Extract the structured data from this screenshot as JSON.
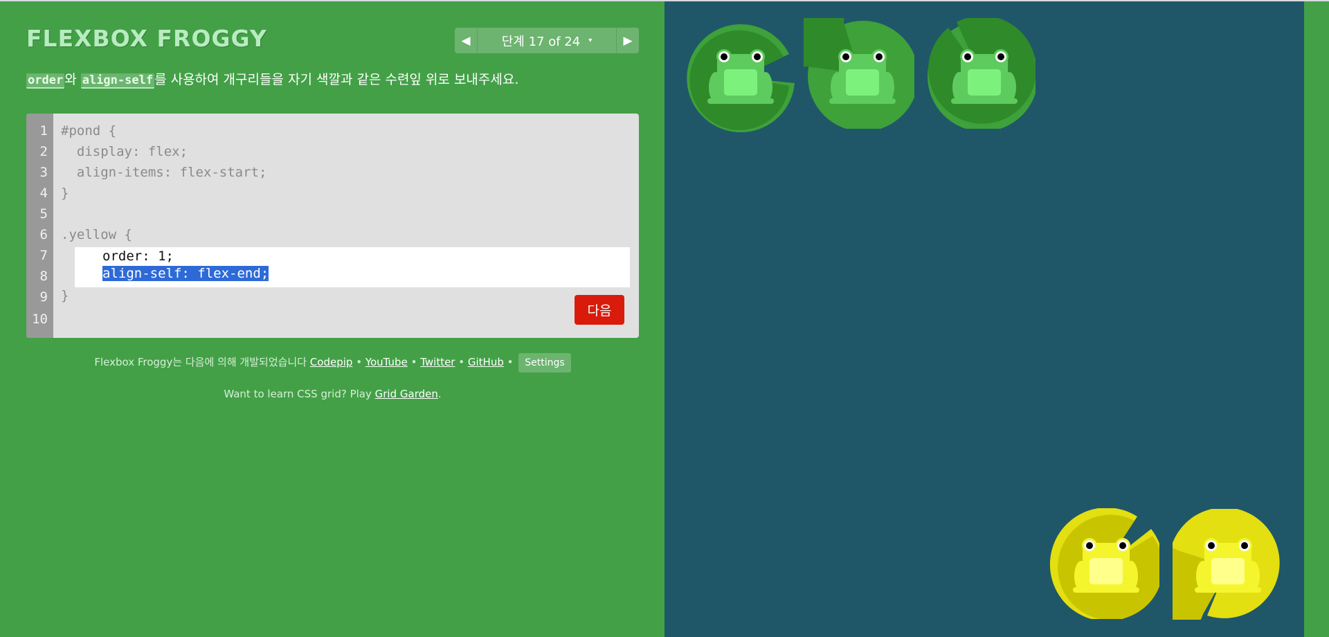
{
  "app": {
    "title": "FLEXBOX FROGGY"
  },
  "level_nav": {
    "prev_glyph": "◀",
    "next_glyph": "▶",
    "level_text": "단계 17 of 24",
    "caret_glyph": "▾"
  },
  "instructions": {
    "kw1": "order",
    "text1": "와 ",
    "kw2": "align-self",
    "text2": "를 사용하여 개구리들을 자기 색깔과 같은 수련잎 위로 보내주세요."
  },
  "editor": {
    "line_numbers": [
      "1",
      "2",
      "3",
      "4",
      "5",
      "6",
      "7",
      "8",
      "9",
      "10"
    ],
    "before": [
      "#pond {",
      "  display: flex;",
      "  align-items: flex-start;",
      "}",
      "",
      ".yellow {"
    ],
    "answer_line1": "order: 1;",
    "answer_line2": "align-self: flex-end;",
    "after": "}",
    "next_label": "다음"
  },
  "credits": {
    "prefix": "Flexbox Froggy는 다음에 의해 개발되었습니다 ",
    "codepip": "Codepip",
    "sep": " • ",
    "youtube": "YouTube",
    "twitter": "Twitter",
    "github": "GitHub",
    "settings": "Settings"
  },
  "promo": {
    "text": "Want to learn CSS grid? Play ",
    "link": "Grid Garden",
    "end": "."
  },
  "colors": {
    "background": "#43a047",
    "pond": "#1f5768",
    "green_pad": "#2f8a2a",
    "green_pad_light": "#3ea13a",
    "green_frog": "#5ecb5e",
    "green_frog_belly": "#7cf27c",
    "yellow_pad": "#c9c400",
    "yellow_pad_light": "#e3df10",
    "yellow_frog": "#f5f52e",
    "yellow_frog_belly": "#ffff8c",
    "next_button": "#d91b0c",
    "selection": "#2d6ad8"
  },
  "pond": {
    "green_frogs": 3,
    "yellow_frogs": 2
  }
}
